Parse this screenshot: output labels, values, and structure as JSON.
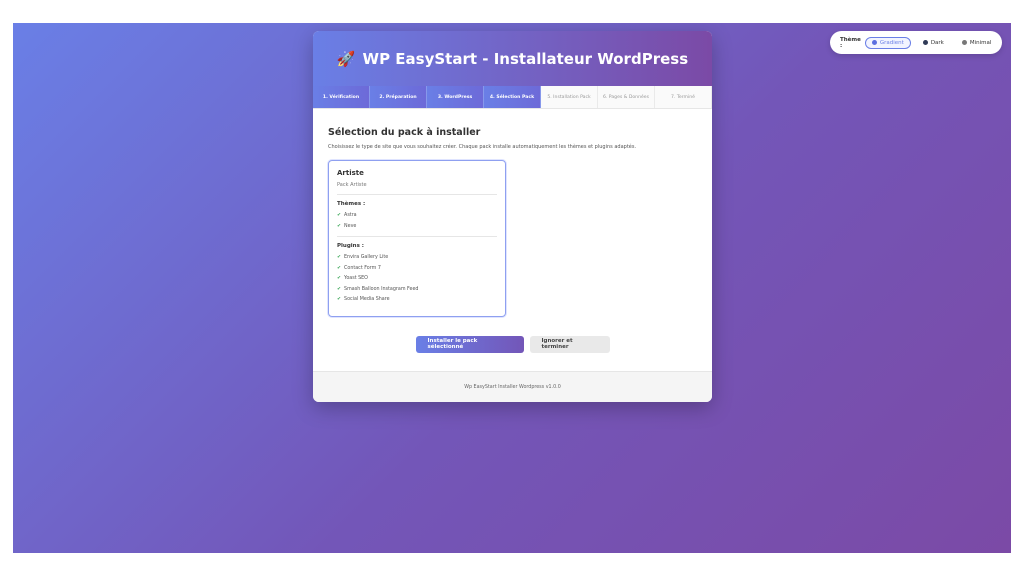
{
  "theme_switcher": {
    "label": "Thème :",
    "options": [
      {
        "label": "Gradient",
        "color": "#5b6fe0",
        "active": true
      },
      {
        "label": "Dark",
        "color": "#2f3a56",
        "active": false
      },
      {
        "label": "Minimal",
        "color": "#777777",
        "active": false
      }
    ]
  },
  "header": {
    "icon": "rocket-icon",
    "emoji": "🚀",
    "title": "WP EasyStart - Installateur WordPress"
  },
  "steps": [
    {
      "label": "1. Vérification",
      "state": "done"
    },
    {
      "label": "2. Préparation",
      "state": "done"
    },
    {
      "label": "3. WordPress",
      "state": "done"
    },
    {
      "label": "4. Sélection Pack",
      "state": "done"
    },
    {
      "label": "5. Installation Pack",
      "state": "pending"
    },
    {
      "label": "6. Pages & Données",
      "state": "pending"
    },
    {
      "label": "7. Terminé",
      "state": "pending"
    }
  ],
  "main": {
    "title": "Sélection du pack à installer",
    "subtitle": "Choisissez le type de site que vous souhaitez créer. Chaque pack installe automatiquement les thèmes et plugins adaptés.",
    "pack": {
      "name": "Artiste",
      "description": "Pack Artiste",
      "themes_label": "Thèmes :",
      "themes": [
        "Astra",
        "Neve"
      ],
      "plugins_label": "Plugins :",
      "plugins": [
        "Envira Gallery Lite",
        "Contact Form 7",
        "Yoast SEO",
        "Smash Balloon Instagram Feed",
        "Social Media Share"
      ]
    },
    "buttons": {
      "install_label": "Installer le pack sélectionné",
      "skip_label": "Ignorer et terminer"
    }
  },
  "footer": {
    "text": "Wp EasyStart Installer Wordpress v1.0.0"
  },
  "colors": {
    "accent": "#6a7fe6",
    "accent2": "#7b4aa6",
    "check": "#3aa657"
  }
}
